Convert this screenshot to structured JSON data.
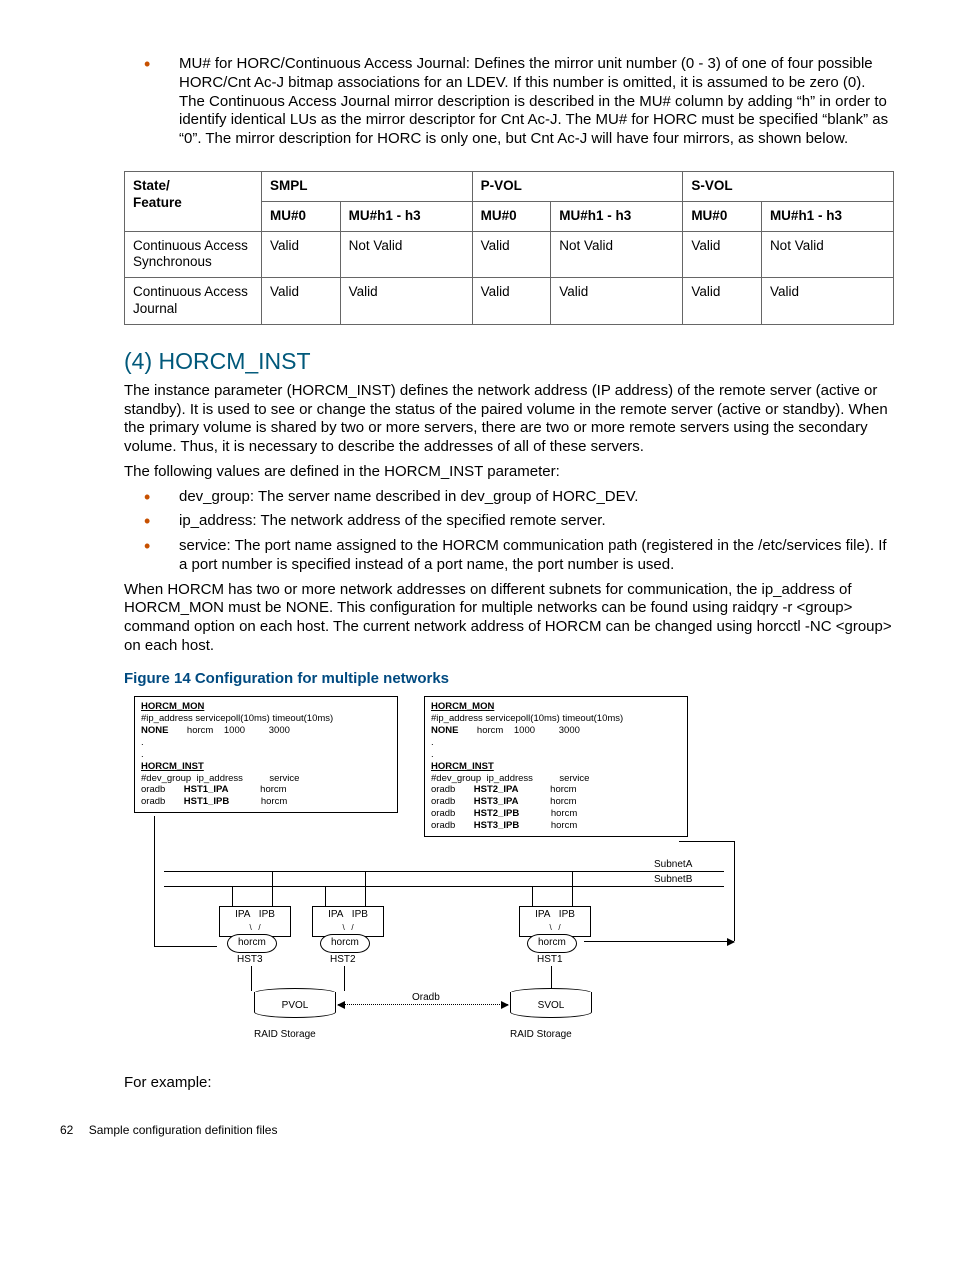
{
  "intro_bullet": "MU# for HORC/Continuous Access Journal: Defines the mirror unit number (0 - 3) of one of four possible HORC/Cnt Ac-J bitmap associations for an LDEV. If this number is omitted, it is assumed to be zero (0). The Continuous Access Journal mirror description is described in the MU# column by adding “h” in order to identify identical LUs as the mirror descriptor for Cnt Ac-J. The MU# for HORC must be specified “blank” as “0”. The mirror description for HORC is only one, but Cnt Ac-J will have four mirrors, as shown below.",
  "table": {
    "head_row1": {
      "c1": "State/",
      "c2": "SMPL",
      "c3": "P-VOL",
      "c4": "S-VOL"
    },
    "head_row1b": "Feature",
    "head_row2": {
      "a": "MU#0",
      "b": "MU#h1 - h3"
    },
    "rows": [
      {
        "name": "Continuous Access Synchronous",
        "v": [
          "Valid",
          "Not Valid",
          "Valid",
          "Not Valid",
          "Valid",
          "Not Valid"
        ]
      },
      {
        "name": "Continuous Access Journal",
        "v": [
          "Valid",
          "Valid",
          "Valid",
          "Valid",
          "Valid",
          "Valid"
        ]
      }
    ]
  },
  "section_title": "(4) HORCM_INST",
  "p1": "The instance parameter (HORCM_INST) defines the network address (IP address) of the remote server (active or standby). It is used to see or change the status of the paired volume in the remote server (active or standby). When the primary volume is shared by two or more servers, there are two or more remote servers using the secondary volume. Thus, it is necessary to describe the addresses of all of these servers.",
  "p2": "The following values are defined in the HORCM_INST parameter:",
  "bullets": [
    "dev_group: The server name described in dev_group of HORC_DEV.",
    "ip_address: The network address of the specified remote server.",
    "service: The port name assigned to the HORCM communication path (registered in the /etc/services file). If a port number is specified instead of a port name, the port number is used."
  ],
  "p3": "When HORCM has two or more network addresses on different subnets for communication, the ip_address of HORCM_MON must be NONE. This configuration for multiple networks can be found using raidqry -r <group> command option on each host. The current network address of HORCM can be changed using horcctl -NC <group> on each host.",
  "fig_caption": "Figure 14 Configuration for multiple networks",
  "fig": {
    "left_box": "HORCM_MON\n#ip_address servicepoll(10ms) timeout(10ms)\nNONE       horcm    1000         3000\n.\n.\nHORCM_INST\n#dev_group  ip_address          service\noradb       HST1_IPA            horcm\noradb       HST1_IPB            horcm",
    "right_box": "HORCM_MON\n#ip_address servicepoll(10ms) timeout(10ms)\nNONE       horcm    1000         3000\n.\n.\nHORCM_INST\n#dev_group  ip_address          service\noradb       HST2_IPA            horcm\noradb       HST3_IPA            horcm\noradb       HST2_IPB            horcm\noradb       HST3_IPB            horcm",
    "subnetA": "SubnetA",
    "subnetB": "SubnetB",
    "ipa": "IPA",
    "ipb": "IPB",
    "horcm": "horcm",
    "hst1": "HST1",
    "hst2": "HST2",
    "hst3": "HST3",
    "pvol": "PVOL",
    "svol": "SVOL",
    "oradb": "Oradb",
    "raid": "RAID Storage"
  },
  "for_example": "For example:",
  "footer": {
    "page": "62",
    "text": "Sample configuration definition files"
  }
}
